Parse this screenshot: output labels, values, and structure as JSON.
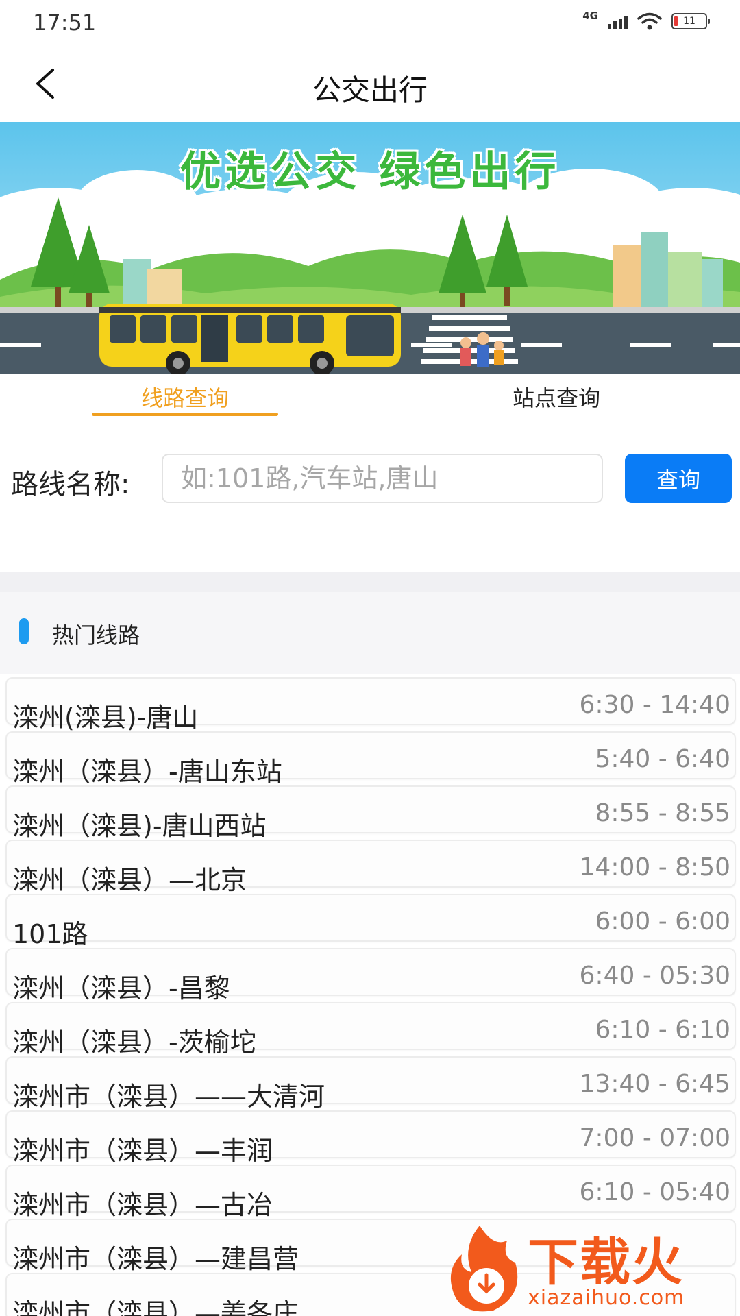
{
  "status_bar": {
    "time": "17:51",
    "network": "4G",
    "battery": "11",
    "icons": [
      "signal-icon",
      "wifi-icon",
      "battery-icon"
    ]
  },
  "nav": {
    "title": "公交出行",
    "back_icon": "chevron-left-icon"
  },
  "banner": {
    "slogan": "优选公交  绿色出行"
  },
  "tabs": [
    {
      "label": "线路查询",
      "active": true
    },
    {
      "label": "站点查询",
      "active": false
    }
  ],
  "search": {
    "label": "路线名称:",
    "placeholder": "如:101路,汽车站,唐山",
    "value": "",
    "button_label": "查询"
  },
  "hot_routes": {
    "title": "热门线路",
    "items": [
      {
        "name": "滦州(滦县)-唐山",
        "time": "6:30 - 14:40"
      },
      {
        "name": "滦州（滦县）-唐山东站",
        "time": "5:40 - 6:40"
      },
      {
        "name": "滦州（滦县)-唐山西站",
        "time": "8:55 - 8:55"
      },
      {
        "name": "滦州（滦县）—北京",
        "time": "14:00 - 8:50"
      },
      {
        "name": "101路",
        "time": "6:00 - 6:00"
      },
      {
        "name": "滦州（滦县）-昌黎",
        "time": "6:40 - 05:30"
      },
      {
        "name": "滦州（滦县）-茨榆坨",
        "time": "6:10 - 6:10"
      },
      {
        "name": "滦州市（滦县）——大清河",
        "time": "13:40 - 6:45"
      },
      {
        "name": "滦州市（滦县）—丰润",
        "time": "7:00 - 07:00"
      },
      {
        "name": "滦州市（滦县）—古冶",
        "time": "6:10 - 05:40"
      },
      {
        "name": "滦州市（滦县）—建昌营",
        "time": ""
      },
      {
        "name": "滦州市（滦县）—姜各庄",
        "time": ""
      }
    ]
  },
  "watermark": {
    "brand": "下载火",
    "domain": "xiazaihuo.com"
  },
  "colors": {
    "accent_orange": "#f0a020",
    "button_blue": "#0a7cf6",
    "marker_blue": "#1d9bf0",
    "slogan_green": "#3cb83c",
    "watermark_orange": "#f25a1c"
  }
}
